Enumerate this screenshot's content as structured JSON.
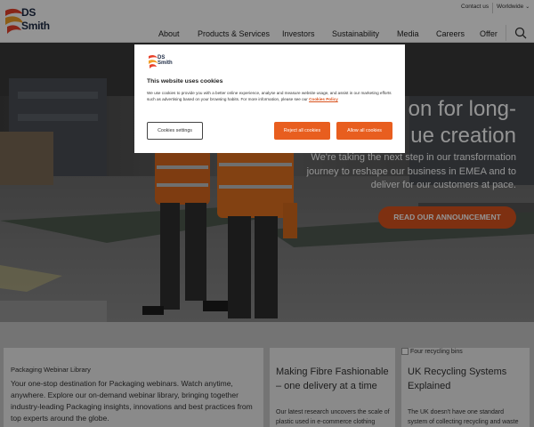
{
  "header": {
    "logo_text_line1": "DS",
    "logo_text_line2": "Smith",
    "utility": {
      "contact": "Contact us",
      "worldwide": "Worldwide"
    },
    "nav": [
      "About",
      "Products & Services",
      "Investors",
      "Sustainability",
      "Media",
      "Careers",
      "Offer"
    ],
    "search_icon": "search-icon"
  },
  "hero": {
    "title_line1": "on for long-",
    "title_line2": "ue creation",
    "subtitle": "We're taking the next step in our transformation journey to reshape our business in EMEA and to deliver for our customers at pace.",
    "cta": "READ OUR ANNOUNCEMENT"
  },
  "cards": {
    "webinar": {
      "eyebrow": "Packaging Webinar Library",
      "body": "Your one-stop destination for Packaging webinars. Watch anytime, anywhere. Explore our on-demand webinar library, bringing together industry-leading Packaging insights, innovations and best practices from top experts around the globe."
    },
    "fibre": {
      "title": "Making Fibre Fashionable – one delivery at a time",
      "body": "Our latest research uncovers the scale of plastic used in e-commerce clothing packaging, and sheds light"
    },
    "recycling": {
      "image_alt": "Four recycling bins",
      "title": "UK Recycling Systems Explained",
      "body": "The UK doesn't have one standard system of collecting recycling and waste materials. We break down the"
    }
  },
  "cookie_dialog": {
    "logo_text_line1": "DS",
    "logo_text_line2": "Smith",
    "title": "This website uses cookies",
    "text": "We use cookies to provide you with a better online experience, analyse and measure website usage, and assist in our marketing efforts such as advertising based on your browsing habits. For more information, please see our",
    "policy_link": "Cookies Policy",
    "settings_button": "Cookies settings",
    "reject_button": "Reject all cookies",
    "allow_button": "Allow all cookies"
  },
  "colors": {
    "accent_orange": "#e85e1f",
    "cta_orange": "#d9531e",
    "brand_navy": "#1c2a44"
  }
}
